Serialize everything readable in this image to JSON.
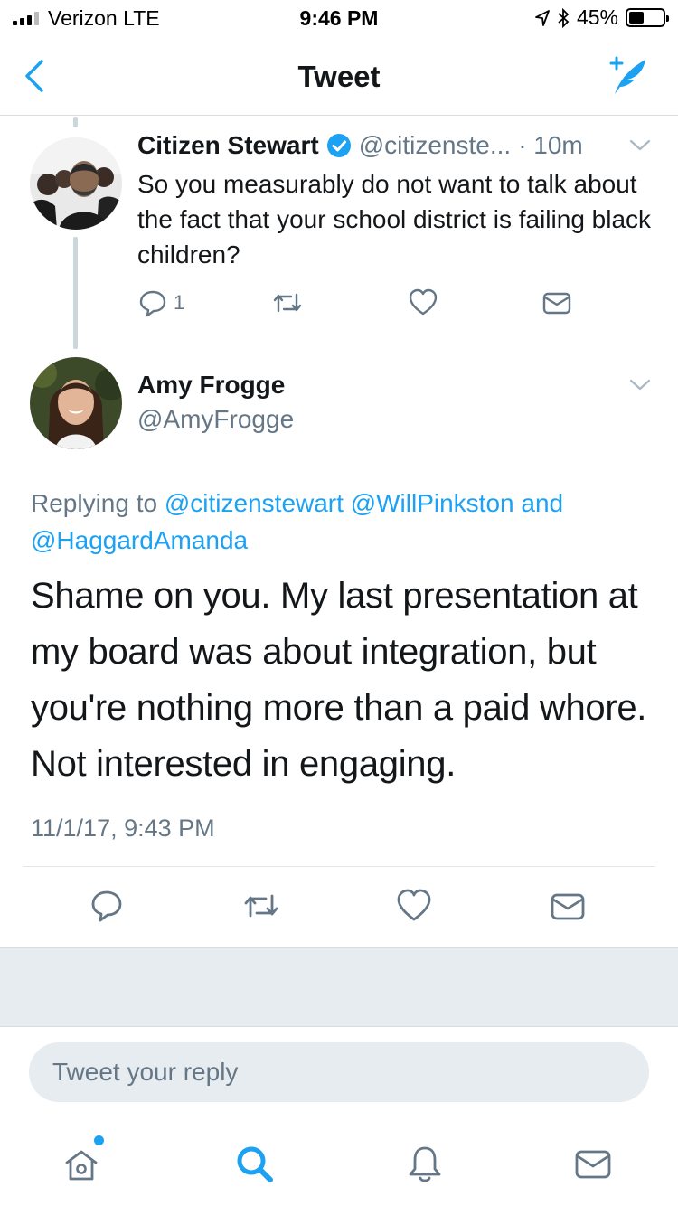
{
  "status_bar": {
    "carrier": "Verizon  LTE",
    "time": "9:46 PM",
    "battery": "45%",
    "battery_level": 0.45
  },
  "nav": {
    "title": "Tweet",
    "back_icon": "chevron-left-icon",
    "compose_icon": "compose-tweet-icon"
  },
  "parent_tweet": {
    "name": "Citizen Stewart",
    "handle": "@citizenste...",
    "time": "· 10m",
    "text": "So you measurably do not want to talk about the fact that your school district is failing black children?",
    "reply_count": "1"
  },
  "main_tweet": {
    "name": "Amy Frogge",
    "handle": "@AmyFrogge",
    "replying_prefix": "Replying to ",
    "mention_1": "@citizenstewart",
    "mention_2": "@WillPinkston",
    "replying_and": " and",
    "mention_3": "@HaggardAmanda",
    "text": "Shame on you. My last presentation at my board was about integration, but you're nothing more than a paid whore. Not interested in engaging.",
    "date": "11/1/17, 9:43 PM"
  },
  "reply_box": {
    "placeholder": "Tweet your reply"
  },
  "tab_bar": {
    "items": [
      "home-icon",
      "search-icon",
      "notifications-icon",
      "messages-icon"
    ]
  },
  "colors": {
    "accent": "#1da1f2",
    "secondary_text": "#657786",
    "separator_band": "#e6ecf0"
  }
}
